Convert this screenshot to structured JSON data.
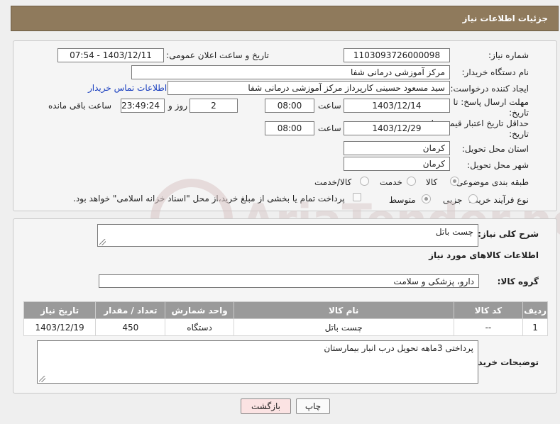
{
  "header": {
    "title": "جزئیات اطلاعات نیاز"
  },
  "form": {
    "need_number_label": "شماره نیاز:",
    "need_number": "1103093726000098",
    "announce_label": "تاریخ و ساعت اعلان عمومی:",
    "announce_value": "1403/12/11 - 07:54",
    "buyer_org_label": "نام دستگاه خریدار:",
    "buyer_org": "مرکز آموزشی درمانی شفا",
    "creator_label": "ایجاد کننده درخواست:",
    "creator": "سید مسعود حسینی کارپرداز مرکز آموزشی درمانی شفا",
    "buyer_contact_link": "اطلاعات تماس خریدار",
    "reply_deadline_label_1": "مهلت ارسال پاسخ: تا",
    "reply_deadline_label_2": "تاریخ:",
    "reply_date": "1403/12/14",
    "time_label": "ساعت",
    "reply_time": "08:00",
    "days_value": "2",
    "days_label": "روز و",
    "remaining_value": "23:49:24",
    "remaining_label": "ساعت باقی مانده",
    "validity_label_1": "حداقل تاریخ اعتبار قیمت: تا",
    "validity_label_2": "تاریخ:",
    "validity_date": "1403/12/29",
    "validity_time": "08:00",
    "province_label": "استان محل تحویل:",
    "province": "کرمان",
    "city_label": "شهر محل تحویل:",
    "city": "کرمان",
    "category_label": "طبقه بندی موضوعی:",
    "category_options": [
      "کالا",
      "خدمت",
      "کالا/خدمت"
    ],
    "process_label": "نوع فرآیند خرید :",
    "process_options": [
      "جزیی",
      "متوسط"
    ],
    "payment_note": "پرداخت تمام یا بخشی از مبلغ خرید،از محل \"اسناد خزانه اسلامی\" خواهد بود."
  },
  "details": {
    "description_label": "شرح کلی نیاز:",
    "description": "چست باتل",
    "goods_info_title": "اطلاعات کالاهای مورد نیاز",
    "goods_group_label": "گروه کالا:",
    "goods_group": "دارو، پزشکی و سلامت",
    "table": {
      "headers": [
        "ردیف",
        "کد کالا",
        "نام کالا",
        "واحد شمارش",
        "تعداد / مقدار",
        "تاریخ نیاز"
      ],
      "rows": [
        [
          "1",
          "--",
          "چست باتل",
          "دستگاه",
          "450",
          "1403/12/19"
        ]
      ]
    },
    "buyer_notes_label": "توضیحات خریدار:",
    "buyer_notes": "پرداختی 3ماهه تحویل درب انبار بیمارستان"
  },
  "buttons": {
    "print": "چاپ",
    "back": "بازگشت"
  },
  "watermark": {
    "text": "AriaTender.neT"
  }
}
